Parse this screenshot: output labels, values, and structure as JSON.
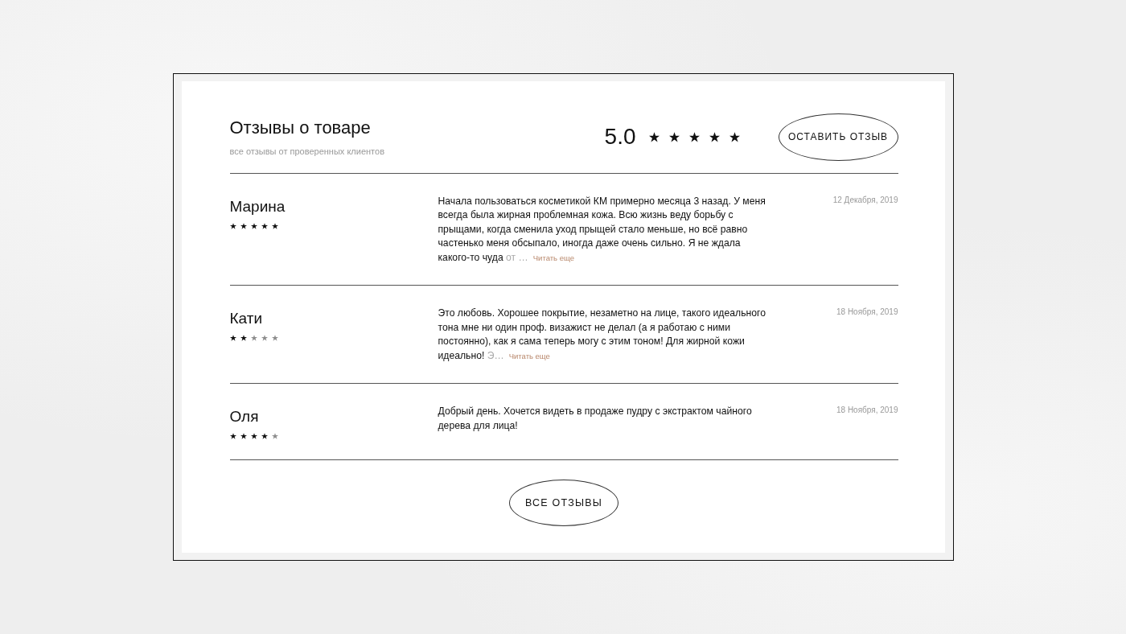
{
  "header": {
    "title": "Отзывы о товаре",
    "subtitle": "все отзывы от проверенных клиентов",
    "rating": "5.0",
    "stars": 5,
    "button": "ОСТАВИТЬ ОТЗЫВ"
  },
  "reviews": [
    {
      "name": "Марина",
      "stars": 5,
      "text": "Начала пользоваться косметикой КМ примерно месяца 3 назад. У меня всегда была жирная проблемная кожа. Всю жизнь веду борьбу с прыщами, когда сменила уход прыщей стало меньше, но всё равно частенько меня обсыпало, иногда даже очень сильно. Я не ждала какого-то чуда",
      "text_faded": "от …",
      "read_more": "Читать еще",
      "date": "12 Декабря, 2019"
    },
    {
      "name": "Кати",
      "stars": 2,
      "text": "Это любовь. Хорошее покрытие, незаметно на лице, такого идеального тона мне ни один проф. визажист не делал (а я работаю с ними постоянно), как я сама теперь могу с этим тоном! Для жирной кожи идеально!",
      "text_faded": "Э…",
      "read_more": "Читать еще",
      "date": "18 Ноября, 2019"
    },
    {
      "name": "Оля",
      "stars": 4,
      "text": "Добрый день. Хочется видеть в продаже пудру с экстрактом чайного дерева для лица!",
      "date": "18 Ноября, 2019"
    }
  ],
  "footer_button": "ВСЕ ОТЗЫВЫ"
}
